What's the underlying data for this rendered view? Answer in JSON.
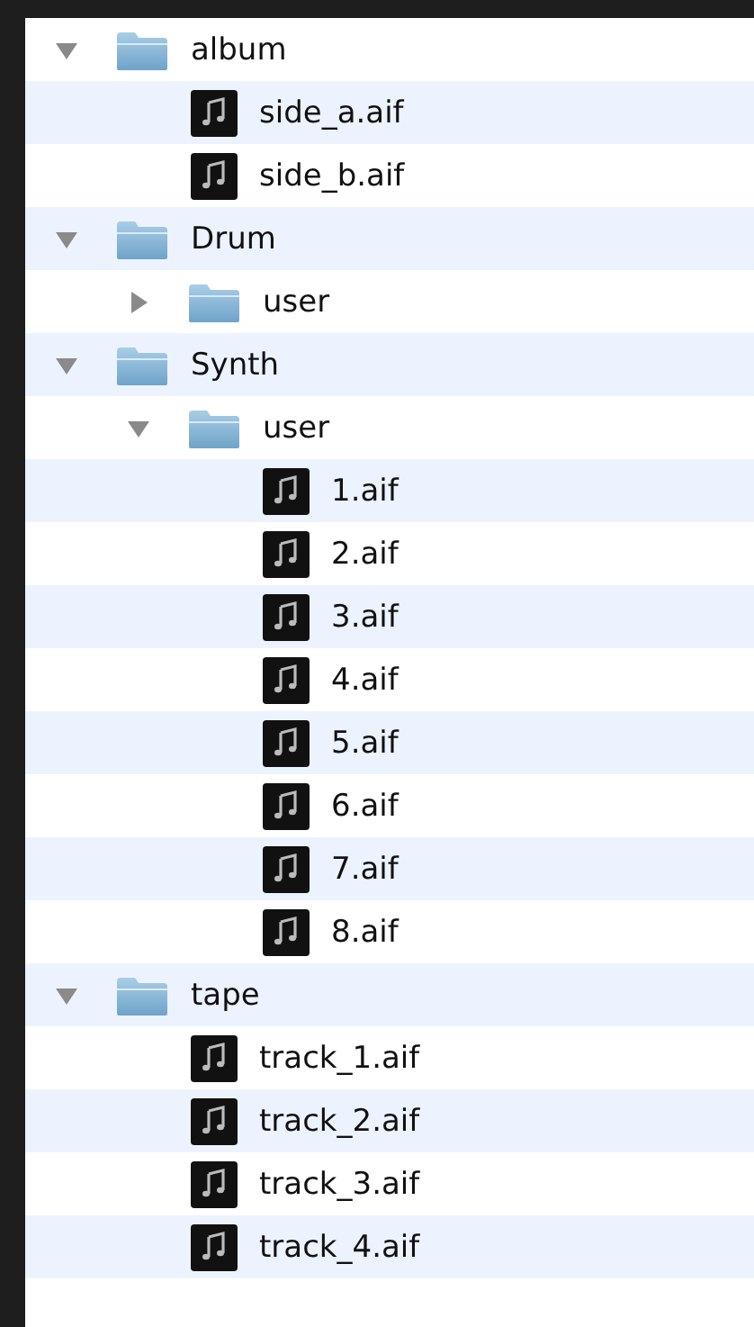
{
  "tree": [
    {
      "kind": "folder",
      "name": "album",
      "expanded": true,
      "children": [
        {
          "kind": "file",
          "name": "side_a.aif"
        },
        {
          "kind": "file",
          "name": "side_b.aif"
        }
      ]
    },
    {
      "kind": "folder",
      "name": "Drum",
      "expanded": true,
      "children": [
        {
          "kind": "folder",
          "name": "user",
          "expanded": false
        }
      ]
    },
    {
      "kind": "folder",
      "name": "Synth",
      "expanded": true,
      "children": [
        {
          "kind": "folder",
          "name": "user",
          "expanded": true,
          "children": [
            {
              "kind": "file",
              "name": "1.aif"
            },
            {
              "kind": "file",
              "name": "2.aif"
            },
            {
              "kind": "file",
              "name": "3.aif"
            },
            {
              "kind": "file",
              "name": "4.aif"
            },
            {
              "kind": "file",
              "name": "5.aif"
            },
            {
              "kind": "file",
              "name": "6.aif"
            },
            {
              "kind": "file",
              "name": "7.aif"
            },
            {
              "kind": "file",
              "name": "8.aif"
            }
          ]
        }
      ]
    },
    {
      "kind": "folder",
      "name": "tape",
      "expanded": true,
      "children": [
        {
          "kind": "file",
          "name": "track_1.aif"
        },
        {
          "kind": "file",
          "name": "track_2.aif"
        },
        {
          "kind": "file",
          "name": "track_3.aif"
        },
        {
          "kind": "file",
          "name": "track_4.aif"
        }
      ]
    }
  ]
}
